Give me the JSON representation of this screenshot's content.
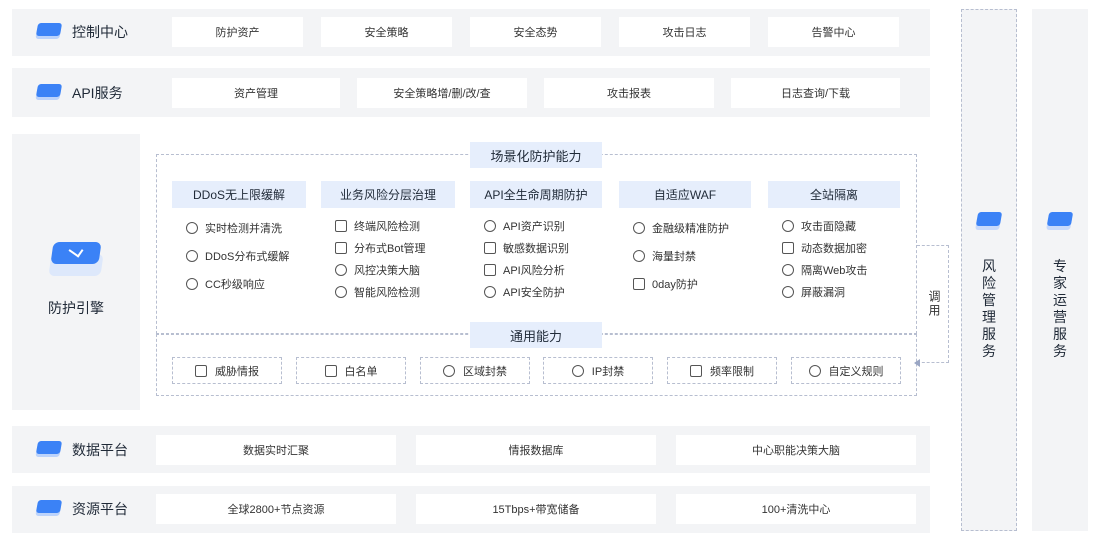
{
  "rows": {
    "control": {
      "title": "控制中心",
      "items": [
        "防护资产",
        "安全策略",
        "安全态势",
        "攻击日志",
        "告警中心"
      ]
    },
    "api": {
      "title": "API服务",
      "items": [
        "资产管理",
        "安全策略增/删/改/查",
        "攻击报表",
        "日志查询/下载"
      ]
    },
    "data": {
      "title": "数据平台",
      "items": [
        "数据实时汇聚",
        "情报数据库",
        "中心职能决策大脑"
      ]
    },
    "resource": {
      "title": "资源平台",
      "items": [
        "全球2800+节点资源",
        "15Tbps+带宽储备",
        "100+清洗中心"
      ]
    }
  },
  "engine": {
    "title": "防护引擎"
  },
  "scenario": {
    "title": "场景化防护能力",
    "cards": [
      {
        "title": "DDoS无上限缓解",
        "features": [
          "实时检测并清洗",
          "DDoS分布式缓解",
          "CC秒级响应"
        ],
        "icons": [
          "search-icon",
          "gear-icon",
          "shield-icon"
        ]
      },
      {
        "title": "业务风险分层治理",
        "features": [
          "终端风险检测",
          "分布式Bot管理",
          "风控决策大脑",
          "智能风险检测"
        ],
        "icons": [
          "warning-icon",
          "bot-icon",
          "decision-icon",
          "radar-icon"
        ]
      },
      {
        "title": "API全生命周期防护",
        "features": [
          "API资产识别",
          "敏感数据识别",
          "API风险分析",
          "API安全防护"
        ],
        "icons": [
          "scan-icon",
          "document-search-icon",
          "api-icon",
          "shield-check-icon"
        ]
      },
      {
        "title": "自适应WAF",
        "features": [
          "金融级精准防护",
          "海量封禁",
          "0day防护"
        ],
        "icons": [
          "finance-shield-icon",
          "ban-icon",
          "zero-day-icon"
        ]
      },
      {
        "title": "全站隔离",
        "features": [
          "攻击面隐藏",
          "动态数据加密",
          "隔离Web攻击",
          "屏蔽漏洞"
        ],
        "icons": [
          "hide-icon",
          "encrypt-icon",
          "isolate-icon",
          "block-icon"
        ]
      }
    ]
  },
  "general": {
    "title": "通用能力",
    "items": [
      "威胁情报",
      "白名单",
      "区域封禁",
      "IP封禁",
      "频率限制",
      "自定义规则"
    ],
    "icons": [
      "intel-icon",
      "whitelist-icon",
      "region-icon",
      "ip-icon",
      "rate-limit-icon",
      "custom-rule-icon"
    ]
  },
  "side": {
    "call_label": "调用",
    "risk": "风险管理服务",
    "expert": "专家运营服务"
  },
  "colors": {
    "accent": "#3b82f6",
    "band": "#f3f4f6",
    "tag": "#e6eefc"
  }
}
